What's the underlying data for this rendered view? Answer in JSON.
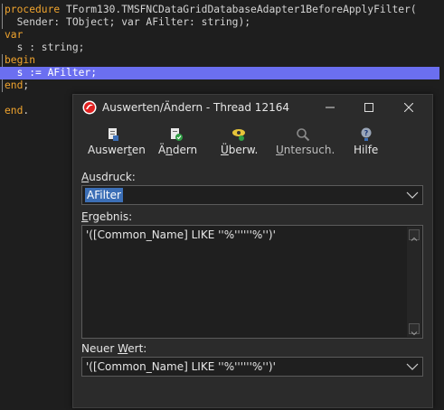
{
  "editor": {
    "lines": [
      {
        "kw": "procedure",
        "text": " TForm130.TMSFNCDataGridDatabaseAdapter1BeforeApplyFilter("
      },
      {
        "kw": "",
        "text": "  Sender: TObject; var AFilter: string);"
      },
      {
        "kw": "var",
        "text": ""
      },
      {
        "kw": "",
        "text": "  s : string;"
      },
      {
        "kw": "begin",
        "text": ""
      },
      {
        "kw": "",
        "text": "  s := AFilter;"
      },
      {
        "kw": "end",
        "text": ";"
      },
      {
        "kw": "",
        "text": ""
      },
      {
        "kw": "end",
        "text": "."
      }
    ]
  },
  "dialog": {
    "title": "Auswerten/Ändern - Thread 12164",
    "toolbar": [
      {
        "pre": "Auswer",
        "ul": "t",
        "post": "en",
        "icon": "evaluate-icon"
      },
      {
        "pre": "Ä",
        "ul": "n",
        "post": "dern",
        "icon": "modify-icon"
      },
      {
        "pre": "",
        "ul": "Ü",
        "post": "berw.",
        "icon": "watch-icon"
      },
      {
        "pre": "",
        "ul": "U",
        "post": "ntersuch.",
        "icon": "inspect-icon"
      },
      {
        "pre": "",
        "ul": "",
        "post": "Hilfe",
        "icon": "help-icon"
      }
    ],
    "expression_label_ul": "A",
    "expression_label_rest": "usdruck:",
    "expression_value": "AFilter",
    "result_label_ul": "E",
    "result_label_rest": "rgebnis:",
    "result_value": "'([Common_Name] LIKE ''%''''''%'')'",
    "new_value_label_pre": "Neuer ",
    "new_value_label_ul": "W",
    "new_value_label_post": "ert:",
    "new_value": "'([Common_Name] LIKE ''%''''''%'')'"
  },
  "colors": {
    "keyword": "#f0a42e",
    "highlight_line": "#6b6ff0",
    "selection": "#3c6fb6"
  }
}
